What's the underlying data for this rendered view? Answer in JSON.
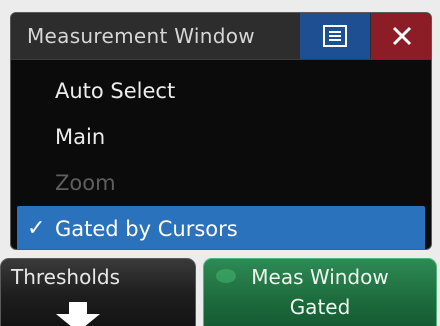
{
  "popup": {
    "title": "Measurement Window",
    "menu_icon": "menu-icon",
    "close_icon": "close-icon",
    "options": [
      {
        "label": "Auto Select",
        "state": "enabled"
      },
      {
        "label": "Main",
        "state": "enabled"
      },
      {
        "label": "Zoom",
        "state": "disabled"
      },
      {
        "label": "Gated by Cursors",
        "state": "selected"
      }
    ],
    "check_glyph": "✓"
  },
  "softkeys": {
    "thresholds": {
      "label": "Thresholds",
      "icon": "down-arrow-icon"
    },
    "meas_window": {
      "line1": "Meas Window",
      "line2": "Gated"
    }
  },
  "colors": {
    "selected_item": "#2a72bb",
    "menu_button": "#1f4f93",
    "close_button": "#8c1d26",
    "active_softkey": "#1c6a3c"
  }
}
